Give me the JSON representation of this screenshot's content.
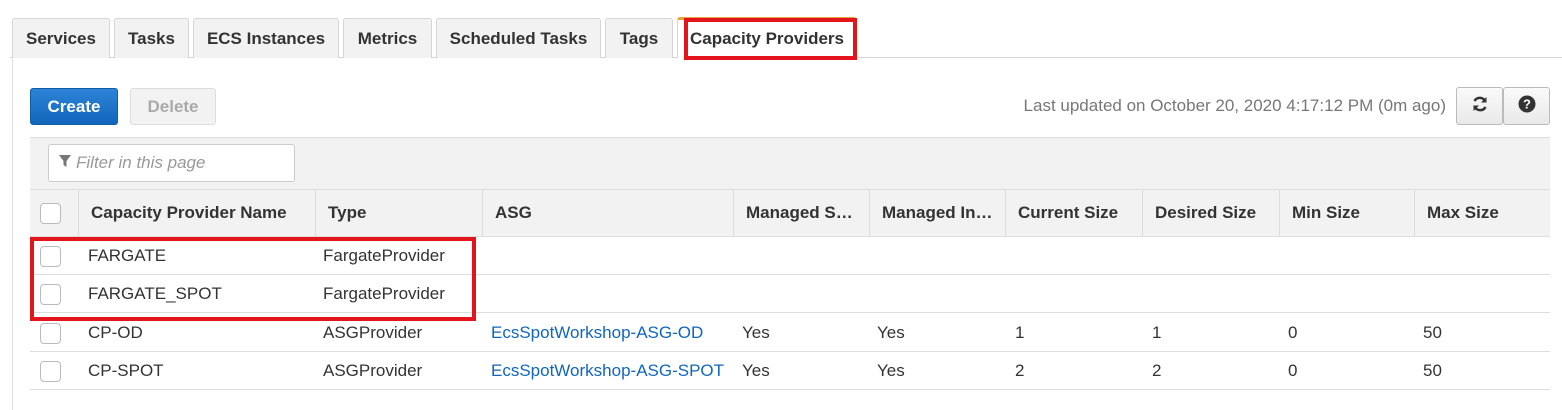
{
  "tabs": [
    {
      "label": "Services"
    },
    {
      "label": "Tasks"
    },
    {
      "label": "ECS Instances"
    },
    {
      "label": "Metrics"
    },
    {
      "label": "Scheduled Tasks"
    },
    {
      "label": "Tags"
    },
    {
      "label": "Capacity Providers",
      "active": true
    }
  ],
  "toolbar": {
    "create_label": "Create",
    "delete_label": "Delete",
    "last_updated": "Last updated on October 20, 2020 4:17:12 PM (0m ago)",
    "refresh_icon": "refresh-icon",
    "help_icon": "help-icon"
  },
  "filter": {
    "placeholder": "Filter in this page",
    "icon": "filter-icon"
  },
  "table": {
    "headers": [
      "Capacity Provider Name",
      "Type",
      "ASG",
      "Managed S…",
      "Managed In…",
      "Current Size",
      "Desired Size",
      "Min Size",
      "Max Size"
    ],
    "rows": [
      {
        "name": "FARGATE",
        "type": "FargateProvider",
        "asg": "",
        "managed_scaling": "",
        "managed_termination": "",
        "current": "",
        "desired": "",
        "min": "",
        "max": ""
      },
      {
        "name": "FARGATE_SPOT",
        "type": "FargateProvider",
        "asg": "",
        "managed_scaling": "",
        "managed_termination": "",
        "current": "",
        "desired": "",
        "min": "",
        "max": ""
      },
      {
        "name": "CP-OD",
        "type": "ASGProvider",
        "asg": "EcsSpotWorkshop-ASG-OD",
        "managed_scaling": "Yes",
        "managed_termination": "Yes",
        "current": "1",
        "desired": "1",
        "min": "0",
        "max": "50"
      },
      {
        "name": "CP-SPOT",
        "type": "ASGProvider",
        "asg": "EcsSpotWorkshop-ASG-SPOT",
        "managed_scaling": "Yes",
        "managed_termination": "Yes",
        "current": "2",
        "desired": "2",
        "min": "0",
        "max": "50"
      }
    ]
  },
  "colors": {
    "highlight": "#e3141b",
    "primary": "#1166bb",
    "active_tab_accent": "#e7a33c"
  }
}
